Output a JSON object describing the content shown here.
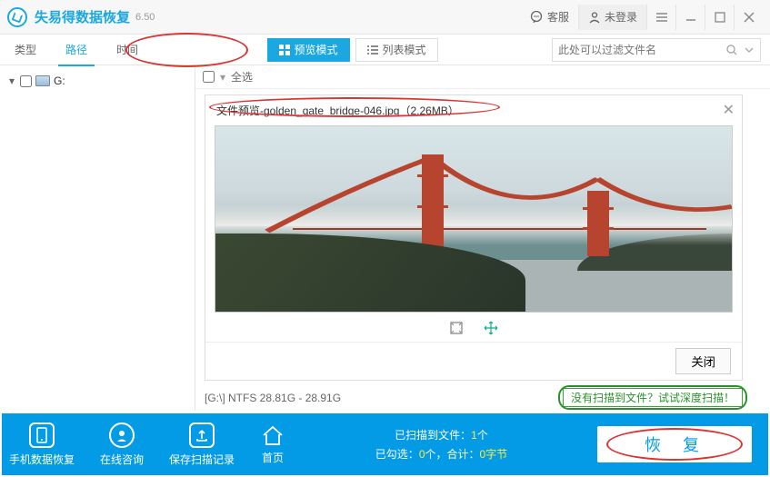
{
  "app": {
    "title": "失易得数据恢复",
    "version": "6.50"
  },
  "titlebar": {
    "support": "客服",
    "login": "未登录"
  },
  "tabs": {
    "type": "类型",
    "path": "路径",
    "time": "时间"
  },
  "modes": {
    "preview": "预览模式",
    "list": "列表模式"
  },
  "search": {
    "placeholder": "此处可以过滤文件名"
  },
  "sidebar": {
    "drive": "G:"
  },
  "toolbar": {
    "select_all": "全选"
  },
  "preview": {
    "title": "文件预览-golden_gate_bridge-046.jpg（2.26MB）",
    "close_btn": "关闭"
  },
  "status": {
    "drive_info": "[G:\\] NTFS 28.81G - 28.91G",
    "deep_scan": "没有扫描到文件？试试深度扫描！"
  },
  "footer": {
    "phone_recover": "手机数据恢复",
    "online_consult": "在线咨询",
    "save_scan": "保存扫描记录",
    "home": "首页",
    "scanned_prefix": "已扫描到文件：",
    "scanned_count": "1",
    "scanned_suffix": "个",
    "selected_prefix": "已勾选：",
    "selected_count": "0",
    "selected_mid": "个，合计：",
    "selected_size": "0字节",
    "recover": "恢复 复"
  },
  "colors": {
    "primary": "#1ba8e0",
    "footer": "#039be5",
    "accent_red": "#d33",
    "accent_green": "#2a912a"
  }
}
